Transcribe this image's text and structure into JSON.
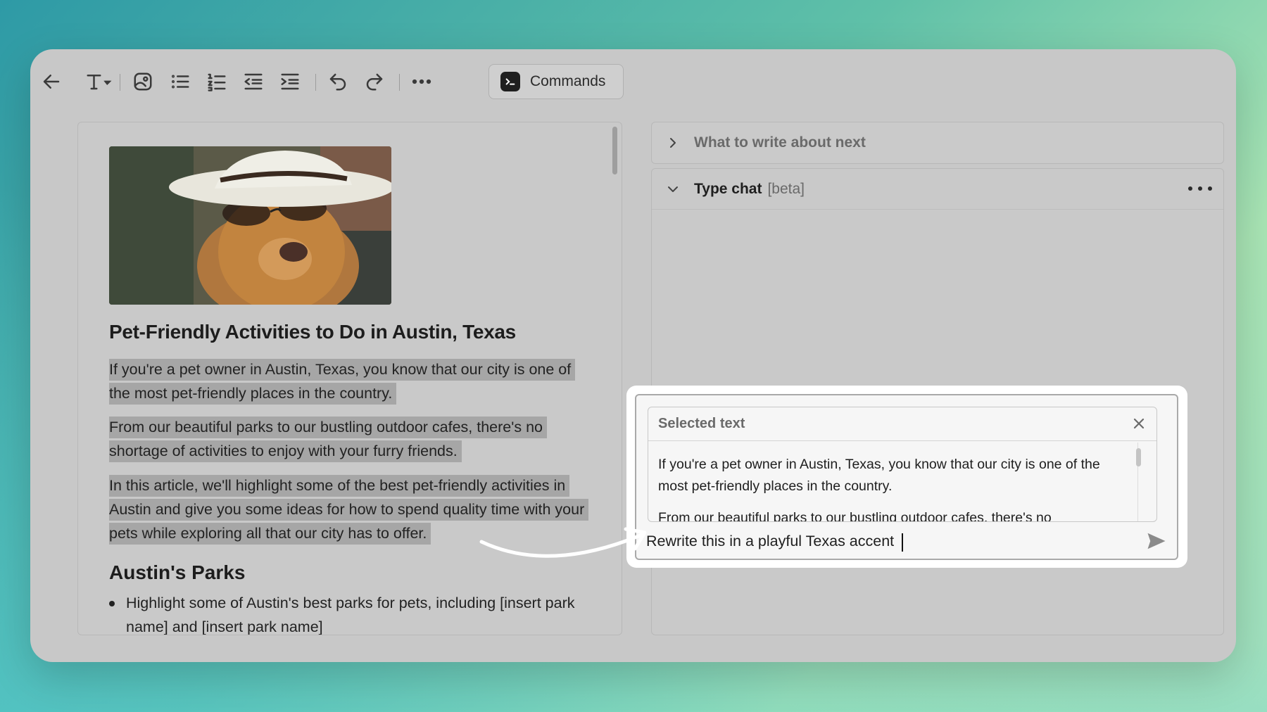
{
  "toolbar": {
    "commands_label": "Commands"
  },
  "document": {
    "title": "Pet-Friendly Activities to Do in Austin, Texas",
    "paragraphs": [
      "If you're a pet owner in Austin, Texas, you know that our city is one of the most pet-friendly places in the country.",
      "From our beautiful parks to our bustling outdoor cafes, there's no shortage of activities to enjoy with your furry friends.",
      "In this article, we'll highlight some of the best pet-friendly activities in Austin and give you some ideas for how to spend quality time with your pets while exploring all that our city has to offer."
    ],
    "section_heading": "Austin's Parks",
    "bullets": [
      "Highlight some of Austin's best parks for pets, including [insert park name] and [insert park name]"
    ]
  },
  "panels": {
    "next_topic": {
      "label": "What to write about next",
      "expanded": false
    },
    "type_chat": {
      "label": "Type chat",
      "badge": "[beta]",
      "expanded": true
    }
  },
  "composer": {
    "selected_title": "Selected text",
    "selected_paragraphs": [
      "If you're a pet owner in Austin, Texas, you know that our city is one of the most pet-friendly places in the country.",
      "From our beautiful parks to our bustling outdoor cafes, there's no"
    ],
    "input_value": "Rewrite this in a playful Texas accent"
  },
  "icons": {
    "back": "arrow-left-icon",
    "text_style": "text-style-icon",
    "image": "image-icon",
    "bullet_list": "bullet-list-icon",
    "numbered_list": "numbered-list-icon",
    "outdent": "outdent-icon",
    "indent": "indent-icon",
    "undo": "undo-icon",
    "redo": "redo-icon",
    "more": "more-icon",
    "send": "send-icon",
    "close": "close-icon"
  },
  "colors": {
    "window_bg": "#c8c8c8",
    "selection_highlight": "#a6a6a6",
    "composer_bg": "#f6f6f6"
  }
}
